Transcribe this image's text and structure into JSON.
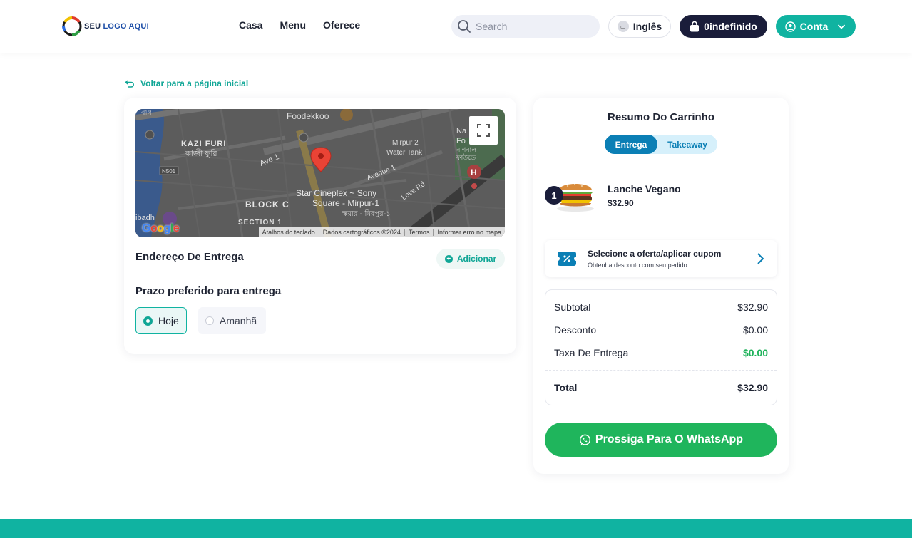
{
  "colors": {
    "accent": "#10b3a1",
    "dark": "#1a1d3a",
    "blue": "#0b7fb5",
    "green": "#1fb55c"
  },
  "header": {
    "logo_text_a": "SEU",
    "logo_text_b": "LOGO AQUI",
    "nav": [
      "Casa",
      "Menu",
      "Oferece"
    ],
    "search_placeholder": "Search",
    "language_label": "Inglês",
    "cart_label": "0indefinido",
    "account_label": "Conta"
  },
  "back_link": "Voltar para a página inicial",
  "map": {
    "labels": {
      "foodekkoo": "Foodekkoo",
      "kazi_furi": "KAZI FURI",
      "kazi_furi_bn": "কাজী ফুরি",
      "ave1": "Ave 1",
      "avenue1": "Avenue 1",
      "mirpur2": "Mirpur 2",
      "water_tank": "Water Tank",
      "block_c": "BLOCK C",
      "star_cineplex": "Star Cineplex ~ Sony",
      "square_mirpur": "Square - Mirpur-1",
      "section1": "SECTION 1",
      "love_rd": "Love Rd",
      "n501": "N501",
      "ibadh": "ibadh",
      "na": "Na",
      "fo": "Fo",
      "bn_top": "বাগ",
      "bn_right": "নাশনাল",
      "bn_right2": "ফাউন্ডে",
      "bn_square": "স্কয়ার - মিরপুর-১"
    },
    "footer": [
      "Atalhos do teclado",
      "Dados cartográficos ©2024",
      "Termos",
      "Informar erro no mapa"
    ],
    "google": "Google"
  },
  "delivery": {
    "address_label": "Endereço De Entrega",
    "add_label": "Adicionar",
    "deadline_label": "Prazo preferido para entrega",
    "options": [
      {
        "label": "Hoje",
        "selected": true
      },
      {
        "label": "Amanhã",
        "selected": false
      }
    ]
  },
  "cart": {
    "title": "Resumo Do Carrinho",
    "modes": [
      "Entrega",
      "Takeaway"
    ],
    "item": {
      "qty": "1",
      "name": "Lanche Vegano",
      "price": "$32.90"
    },
    "coupon": {
      "title": "Selecione a oferta/aplicar cupom",
      "subtitle": "Obtenha desconto com seu pedido"
    },
    "summary": {
      "subtotal_label": "Subtotal",
      "subtotal": "$32.90",
      "discount_label": "Desconto",
      "discount": "$0.00",
      "fee_label": "Taxa De Entrega",
      "fee": "$0.00",
      "total_label": "Total",
      "total": "$32.90"
    },
    "whatsapp_label": "Prossiga Para O WhatsApp"
  }
}
